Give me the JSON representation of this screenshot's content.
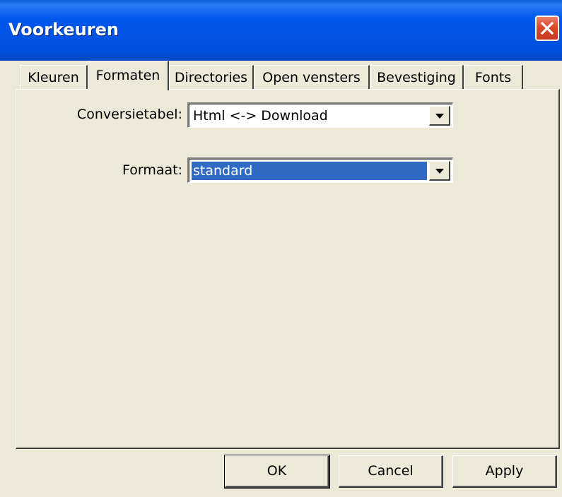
{
  "window": {
    "title": "Voorkeuren"
  },
  "tabs": [
    {
      "label": "Kleuren",
      "active": false
    },
    {
      "label": "Formaten",
      "active": true
    },
    {
      "label": "Directories",
      "active": false
    },
    {
      "label": "Open vensters",
      "active": false
    },
    {
      "label": "Bevestiging",
      "active": false
    },
    {
      "label": "Fonts",
      "active": false
    }
  ],
  "form": {
    "conversietabel": {
      "label": "Conversietabel:",
      "value": "Html <-> Download"
    },
    "formaat": {
      "label": "Formaat:",
      "value": "standard"
    }
  },
  "buttons": {
    "ok": "OK",
    "cancel": "Cancel",
    "apply": "Apply"
  },
  "colors": {
    "titlebar": "#0054E3",
    "selection": "#316AC5",
    "window_bg": "#ECE9D8",
    "close_button": "#D8492A"
  },
  "icons": {
    "close": "close-icon",
    "dropdown": "chevron-down-icon"
  }
}
